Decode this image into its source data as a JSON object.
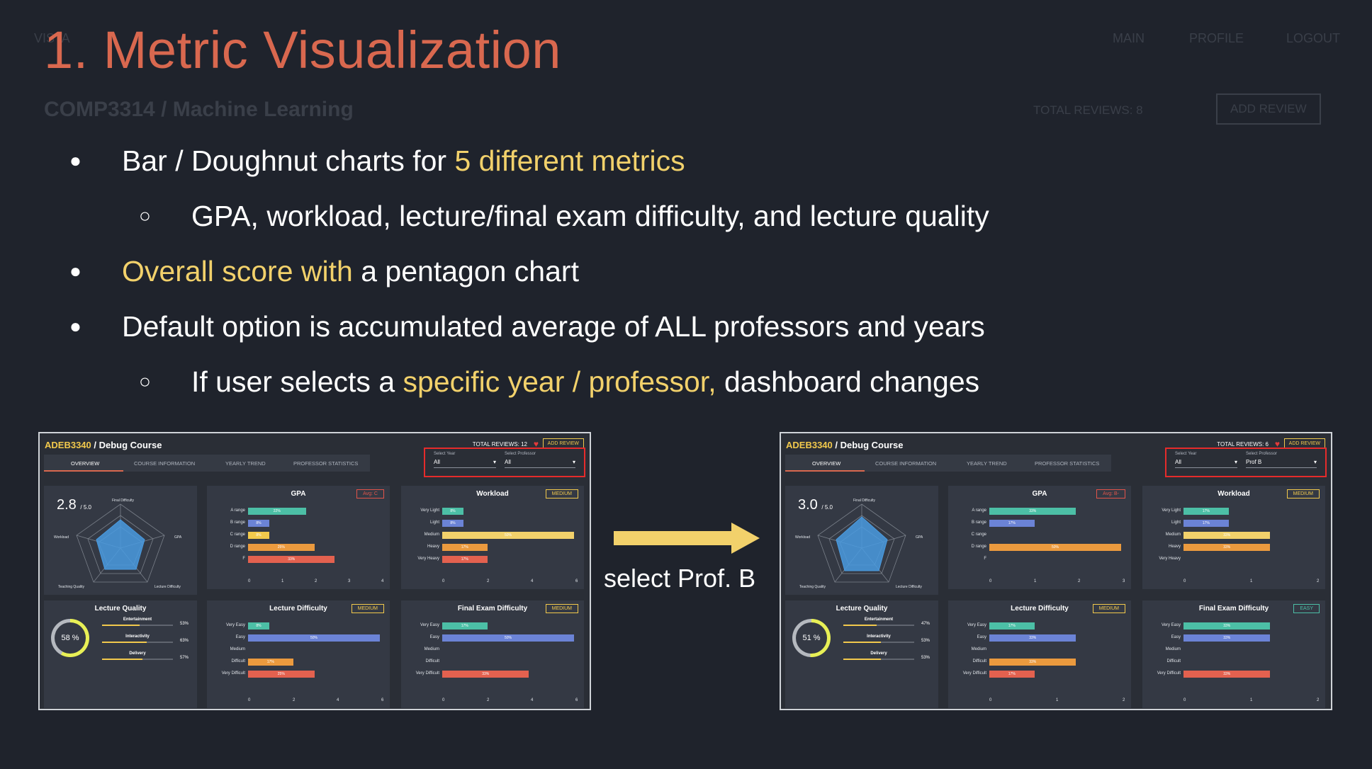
{
  "background": {
    "logo": "VISTA",
    "nav": [
      "MAIN",
      "PROFILE",
      "LOGOUT"
    ],
    "course": "COMP3314 / Machine Learning",
    "total": "TOTAL REVIEWS: 8",
    "add": "ADD REVIEW"
  },
  "slide": {
    "title": "1. Metric Visualization",
    "b1_a": "Bar / Doughnut charts for ",
    "b1_hl": "5 different metrics",
    "b1_sub": "GPA, workload, lecture/final exam difficulty, and lecture quality",
    "b2_hl": "Overall score with",
    "b2_b": " a pentagon chart",
    "b3": "Default option is accumulated average of ALL professors and years",
    "b3_sub_a": "If user selects a ",
    "b3_sub_hl": "specific year / professor,",
    "b3_sub_b": " dashboard changes"
  },
  "arrow_label": "select Prof. B",
  "shots": [
    {
      "code": "ADEB3340",
      "name": "/ Debug Course",
      "total": "TOTAL REVIEWS: 12",
      "add": "ADD REVIEW",
      "tabs": [
        "OVERVIEW",
        "COURSE INFORMATION",
        "YEARLY TREND",
        "PROFESSOR STATISTICS"
      ],
      "year_label": "Select Year",
      "year_value": "All",
      "prof_label": "Select Professor",
      "prof_value": "All",
      "score": "2.8",
      "score_max": "/ 5.0",
      "radar": [
        "Final Difficulty",
        "GPA",
        "Lecture Difficulty",
        "Teaching Quality",
        "Workload"
      ],
      "gpa": {
        "title": "GPA",
        "badge": "Avg: C",
        "rows": [
          [
            "A range",
            "22%"
          ],
          [
            "B range",
            "8%"
          ],
          [
            "C range",
            "8%"
          ],
          [
            "D range",
            "25%"
          ],
          [
            "F",
            "33%"
          ]
        ],
        "ticks": [
          "0",
          "1",
          "2",
          "3",
          "4"
        ]
      },
      "workload": {
        "title": "Workload",
        "badge": "MEDIUM",
        "rows": [
          [
            "Very Light",
            "8%"
          ],
          [
            "Light",
            "8%"
          ],
          [
            "Medium",
            "50%"
          ],
          [
            "Heavy",
            "17%"
          ],
          [
            "Very Heavy",
            "17%"
          ]
        ],
        "ticks": [
          "0",
          "2",
          "4",
          "6"
        ]
      },
      "lec": {
        "title": "Lecture Difficulty",
        "badge": "MEDIUM",
        "rows": [
          [
            "Very Easy",
            "8%"
          ],
          [
            "Easy",
            "50%"
          ],
          [
            "Medium",
            ""
          ],
          [
            "Difficult",
            "17%"
          ],
          [
            "Very Difficult",
            "25%"
          ]
        ],
        "ticks": [
          "0",
          "2",
          "4",
          "6"
        ]
      },
      "final": {
        "title": "Final Exam Difficulty",
        "badge": "MEDIUM",
        "rows": [
          [
            "Very Easy",
            "17%"
          ],
          [
            "Easy",
            "50%"
          ],
          [
            "Medium",
            ""
          ],
          [
            "Difficult",
            ""
          ],
          [
            "Very Difficult",
            "33%"
          ]
        ],
        "ticks": [
          "0",
          "2",
          "4",
          "6"
        ]
      },
      "lq": {
        "title": "Lecture Quality",
        "value": "58 %",
        "items": [
          [
            "Entertainment",
            "53%"
          ],
          [
            "Interactivity",
            "63%"
          ],
          [
            "Delivery",
            "57%"
          ]
        ]
      }
    },
    {
      "code": "ADEB3340",
      "name": "/ Debug Course",
      "total": "TOTAL REVIEWS: 6",
      "add": "ADD REVIEW",
      "tabs": [
        "OVERVIEW",
        "COURSE INFORMATION",
        "YEARLY TREND",
        "PROFESSOR STATISTICS"
      ],
      "year_label": "Select Year",
      "year_value": "All",
      "prof_label": "Select Professor",
      "prof_value": "Prof B",
      "score": "3.0",
      "score_max": "/ 5.0",
      "radar": [
        "Final Difficulty",
        "GPA",
        "Lecture Difficulty",
        "Teaching Quality",
        "Workload"
      ],
      "gpa": {
        "title": "GPA",
        "badge": "Avg: B-",
        "rows": [
          [
            "A range",
            "33%"
          ],
          [
            "B range",
            "17%"
          ],
          [
            "C range",
            ""
          ],
          [
            "D range",
            "50%"
          ],
          [
            "F",
            ""
          ]
        ],
        "ticks": [
          "0",
          "1",
          "2",
          "3"
        ]
      },
      "workload": {
        "title": "Workload",
        "badge": "MEDIUM",
        "rows": [
          [
            "Very Light",
            "17%"
          ],
          [
            "Light",
            "17%"
          ],
          [
            "Medium",
            "33%"
          ],
          [
            "Heavy",
            "33%"
          ],
          [
            "Very Heavy",
            ""
          ]
        ],
        "ticks": [
          "0",
          "1",
          "2"
        ]
      },
      "lec": {
        "title": "Lecture Difficulty",
        "badge": "MEDIUM",
        "rows": [
          [
            "Very Easy",
            "17%"
          ],
          [
            "Easy",
            "33%"
          ],
          [
            "Medium",
            ""
          ],
          [
            "Difficult",
            "33%"
          ],
          [
            "Very Difficult",
            "17%"
          ]
        ],
        "ticks": [
          "0",
          "1",
          "2"
        ]
      },
      "final": {
        "title": "Final Exam Difficulty",
        "badge": "EASY",
        "rows": [
          [
            "Very Easy",
            "33%"
          ],
          [
            "Easy",
            "33%"
          ],
          [
            "Medium",
            ""
          ],
          [
            "Difficult",
            ""
          ],
          [
            "Very Difficult",
            "33%"
          ]
        ],
        "ticks": [
          "0",
          "1",
          "2"
        ]
      },
      "lq": {
        "title": "Lecture Quality",
        "value": "51 %",
        "items": [
          [
            "Entertainment",
            "47%"
          ],
          [
            "Interactivity",
            "53%"
          ],
          [
            "Delivery",
            "53%"
          ]
        ]
      }
    }
  ]
}
